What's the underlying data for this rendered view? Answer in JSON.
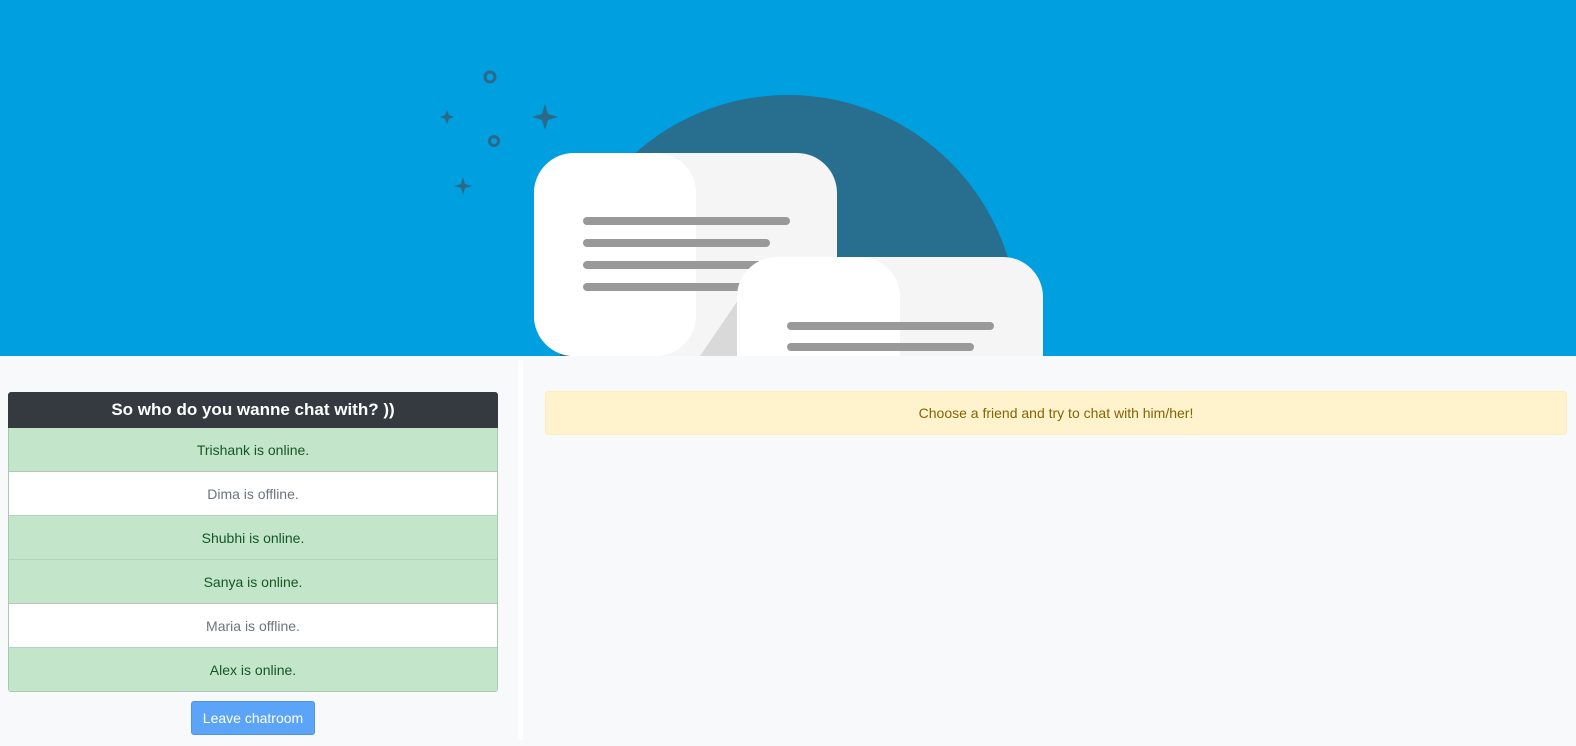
{
  "hero": {
    "illustration": "chat-bubbles-illustration",
    "background_color": "#009fe0"
  },
  "friends_panel": {
    "title": "So who do you wanne chat with? ))",
    "friends": [
      {
        "label": "Trishank is online.",
        "status": "online"
      },
      {
        "label": "Dima is offline.",
        "status": "offline"
      },
      {
        "label": "Shubhi is online.",
        "status": "online"
      },
      {
        "label": "Sanya is online.",
        "status": "online"
      },
      {
        "label": "Maria is offline.",
        "status": "offline"
      },
      {
        "label": "Alex is online.",
        "status": "online"
      }
    ],
    "leave_label": "Leave chatroom"
  },
  "chat_panel": {
    "alert_text": "Choose a friend and try to chat with him/her!"
  },
  "colors": {
    "online": "#c3e6cb",
    "offline": "#ffffff",
    "header": "#343a40",
    "button": "#5ba4f8",
    "alert": "#fff3cd"
  }
}
